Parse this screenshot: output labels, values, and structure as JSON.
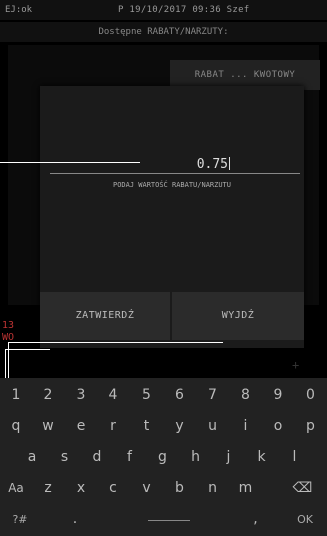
{
  "status": {
    "left": "EJ:ok",
    "center": "P 19/10/2017 09:36 Szef"
  },
  "subtitle": "Dostępne RABATY/NARZUTY:",
  "background": {
    "rabat_button": "RABAT ... KWOTOWY"
  },
  "side_text": {
    "line1": "13",
    "line2": "WO"
  },
  "dialog": {
    "value": "0.75",
    "label": "PODAJ WARTOŚĆ RABATU/NARZUTU",
    "confirm": "ZATWIERDŹ",
    "exit": "WYJDŹ"
  },
  "faint_plus": "+",
  "keyboard": {
    "rows": [
      [
        "1",
        "2",
        "3",
        "4",
        "5",
        "6",
        "7",
        "8",
        "9",
        "0"
      ],
      [
        "q",
        "w",
        "e",
        "r",
        "t",
        "y",
        "u",
        "i",
        "o",
        "p"
      ],
      [
        "a",
        "s",
        "d",
        "f",
        "g",
        "h",
        "j",
        "k",
        "l"
      ],
      [
        "Aa",
        "z",
        "x",
        "c",
        "v",
        "b",
        "n",
        "m",
        "⌫"
      ],
      [
        "?#",
        ".",
        "",
        ",",
        "OK"
      ]
    ]
  }
}
